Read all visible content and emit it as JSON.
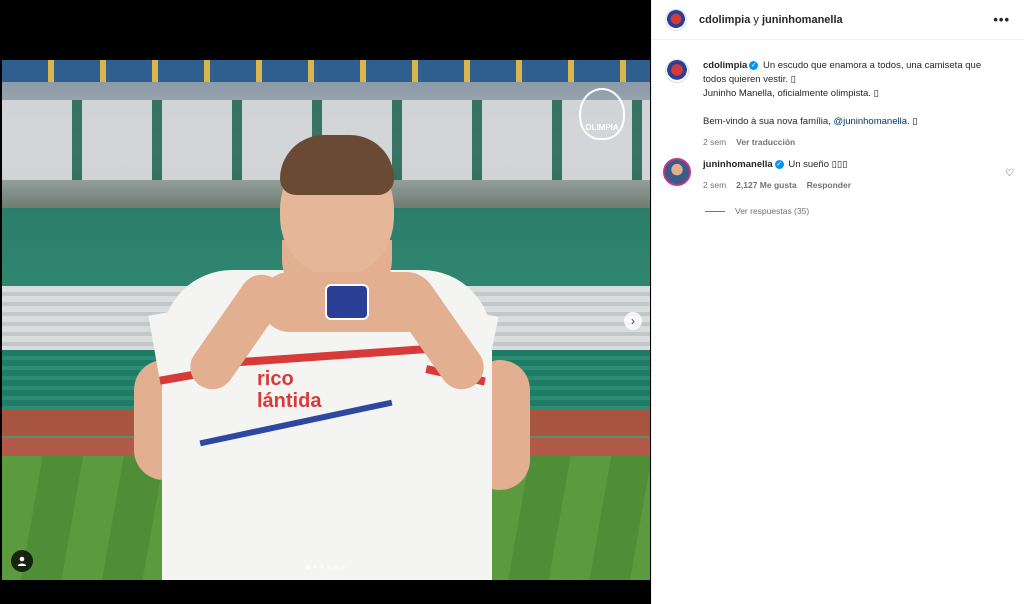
{
  "post": {
    "header_user1": "cdolimpia",
    "header_sep": " y ",
    "header_user2": "juninhomanella",
    "photo_sponsor_line1": "rico",
    "photo_sponsor_line2": "lántida",
    "photo_logo_text": "OLIMPIA",
    "carousel": {
      "total_slides": 6,
      "active_slide": 1
    }
  },
  "caption": {
    "username": "cdolimpia",
    "text1": "Un escudo que enamora a todos, una camiseta que todos quieren vestir. ",
    "emoji1": "▯",
    "text2": "Juninho Manella, oficialmente olimpista. ",
    "emoji2": "▯",
    "text3": "Bem-vindo à sua nova família, ",
    "mention": "@juninhomanella",
    "emoji3": ". ▯",
    "time": "2 sem",
    "translate": "Ver traducción"
  },
  "comment": {
    "username": "juninhomanella",
    "text": "Un sueño ▯▯▯",
    "time": "2 sem",
    "likes": "2,127 Me gusta",
    "reply": "Responder",
    "view_replies": "Ver respuestas (35)"
  },
  "icons": {
    "more": "more-horizontal-icon",
    "heart": "heart-outline-icon",
    "next": "chevron-right-icon",
    "user": "user-tag-icon",
    "verified": "verified-badge-icon"
  },
  "colors": {
    "verified": "#0095f6",
    "mention": "#00376b",
    "muted": "#737373"
  }
}
